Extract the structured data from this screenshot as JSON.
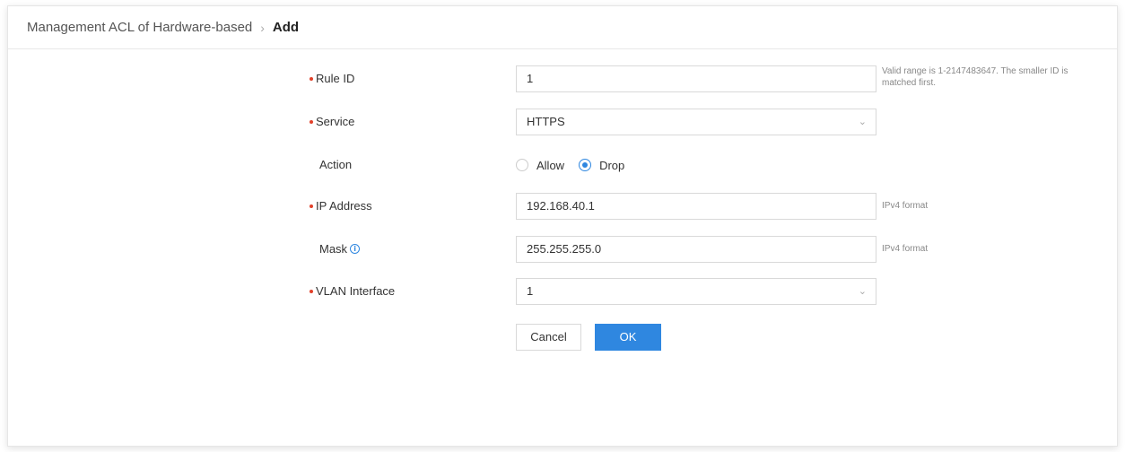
{
  "breadcrumb": {
    "root": "Management ACL of Hardware-based",
    "separator": "›",
    "current": "Add"
  },
  "form": {
    "rule_id": {
      "label": "Rule ID",
      "value": "1",
      "hint": "Valid range is 1-2147483647. The smaller ID is matched first."
    },
    "service": {
      "label": "Service",
      "value": "HTTPS"
    },
    "action": {
      "label": "Action",
      "options": [
        "Allow",
        "Drop"
      ],
      "selected": "Drop"
    },
    "ip_address": {
      "label": "IP Address",
      "value": "192.168.40.1",
      "hint": "IPv4 format"
    },
    "mask": {
      "label": "Mask",
      "value": "255.255.255.0",
      "hint": "IPv4 format"
    },
    "vlan_interface": {
      "label": "VLAN Interface",
      "value": "1"
    }
  },
  "buttons": {
    "cancel": "Cancel",
    "ok": "OK"
  },
  "icons": {
    "info": "info-icon",
    "dropdown": "chevron-down-icon"
  },
  "colors": {
    "accent": "#2f87e0",
    "required_marker": "#e2412a"
  }
}
